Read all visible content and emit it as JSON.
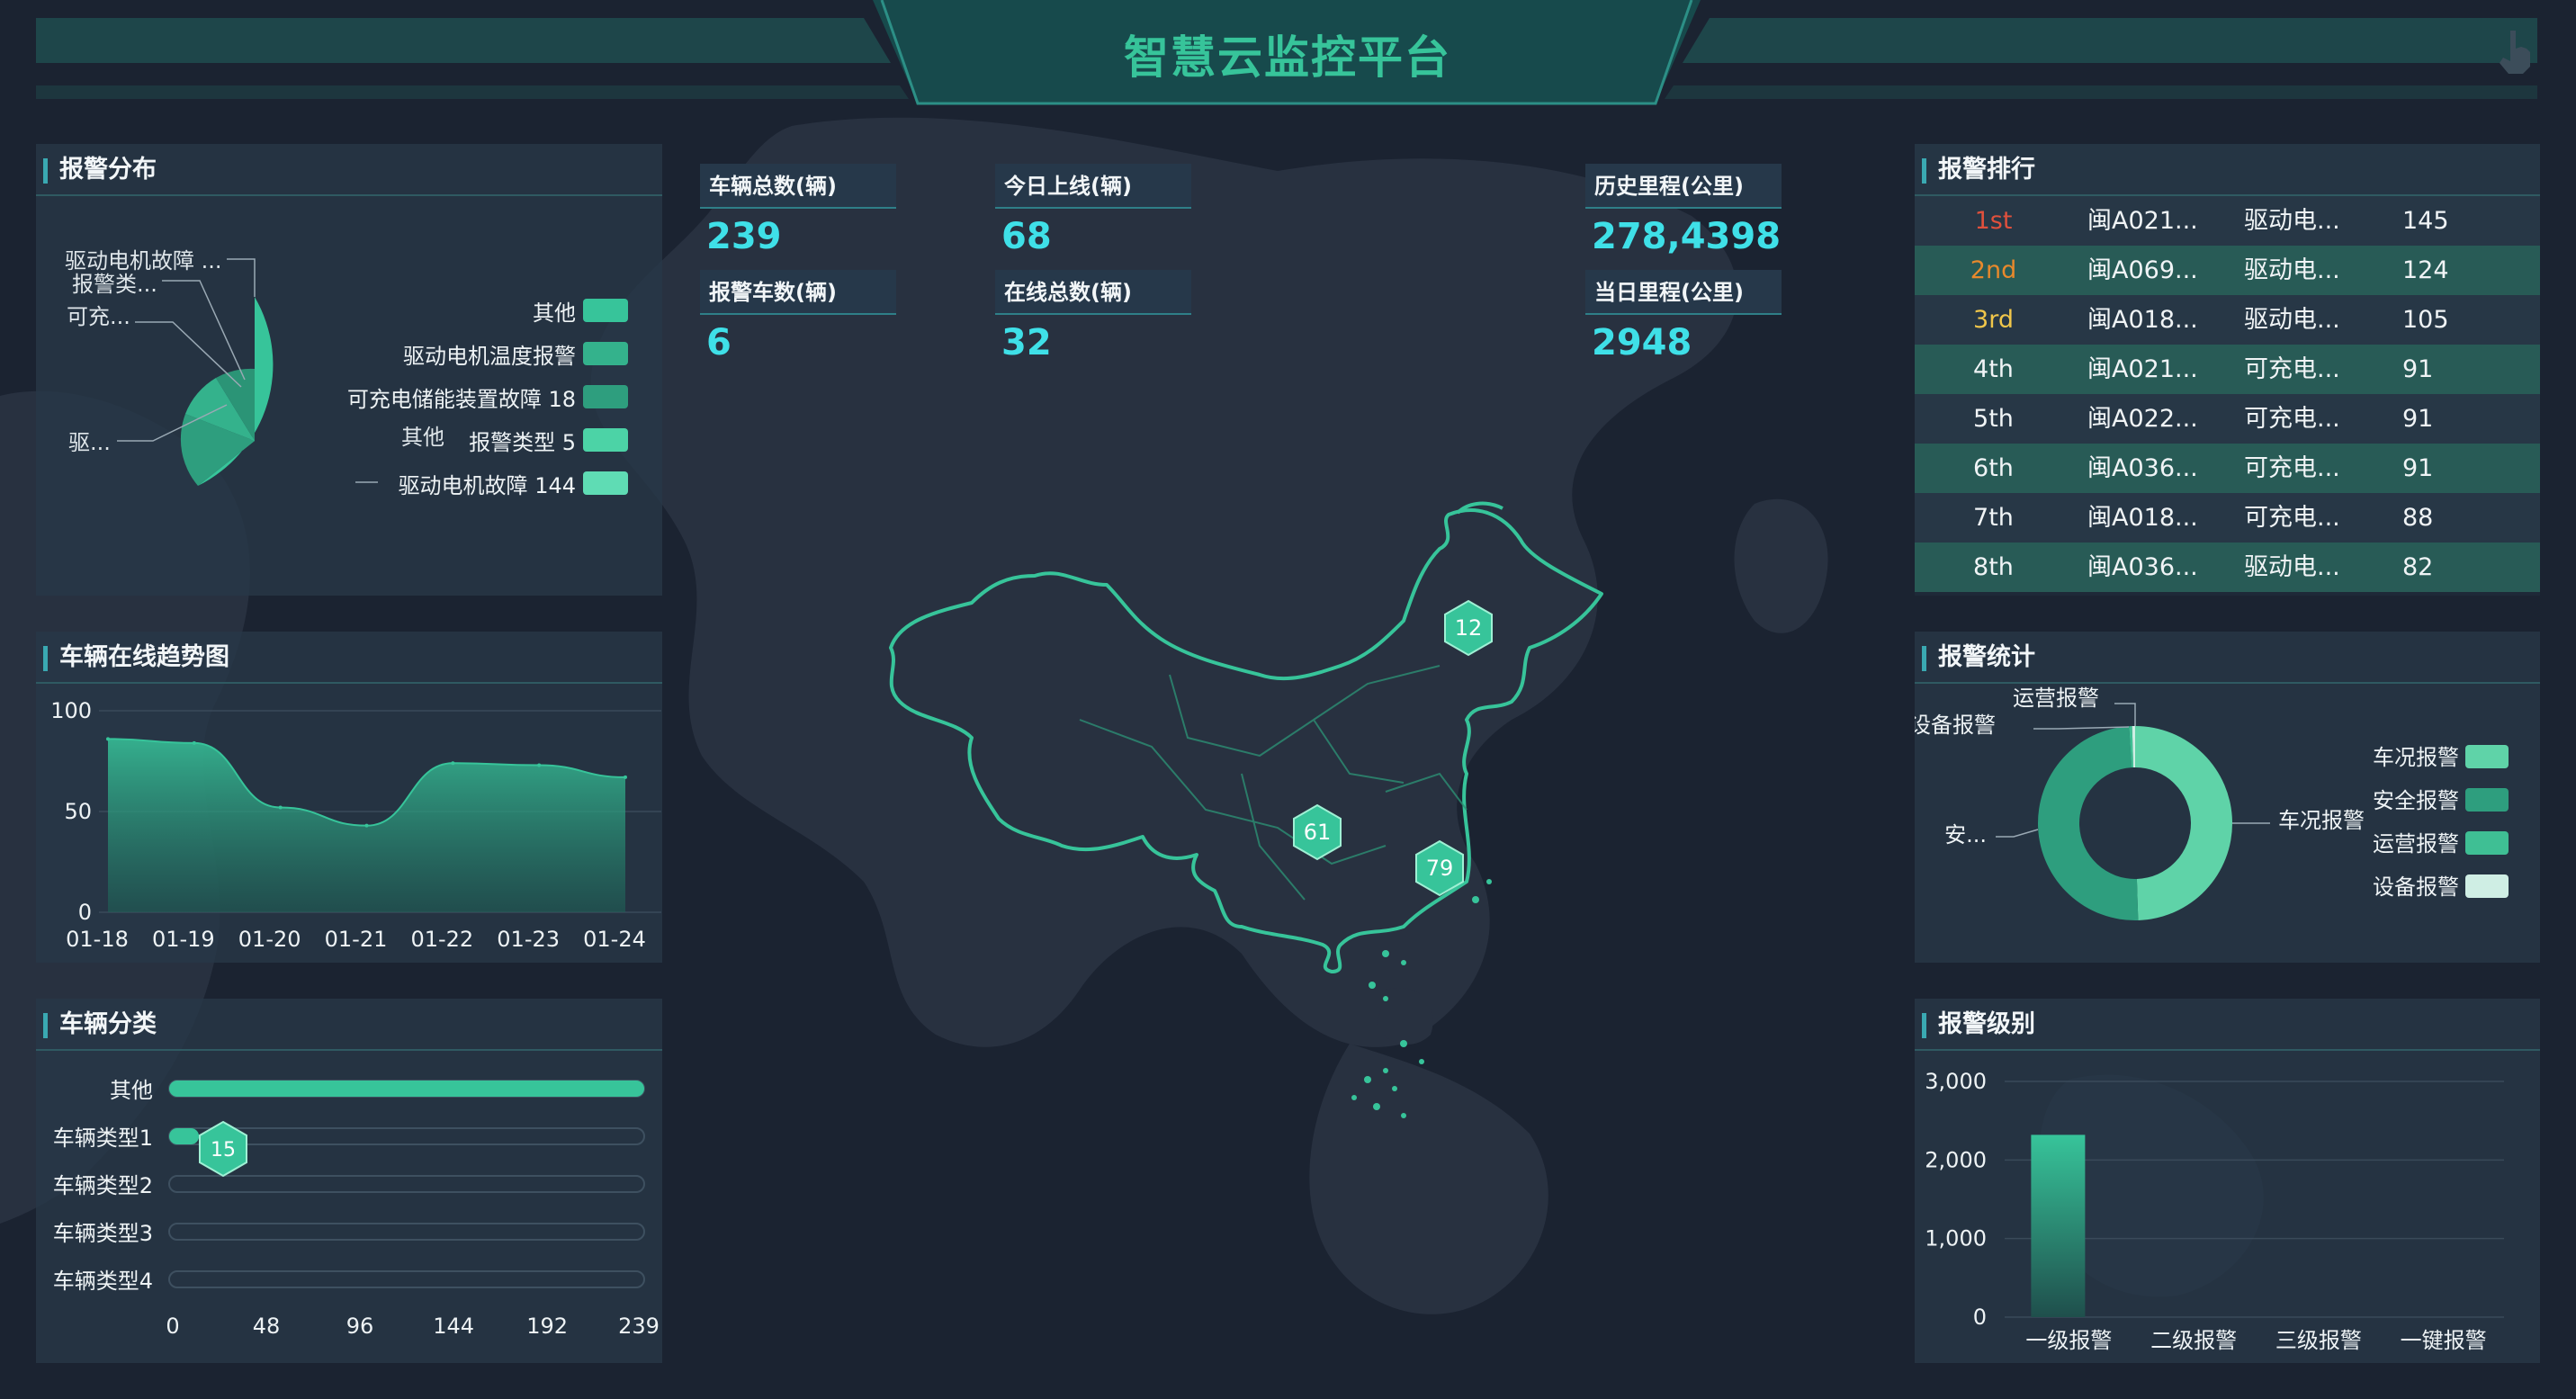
{
  "header": {
    "title": "智慧云监控平台"
  },
  "colors": {
    "accent": "#37c49a",
    "cyan": "#3fe0e8",
    "panel": "#283848",
    "gold": "#f0c64a",
    "red": "#e0503c",
    "orange": "#e8892c"
  },
  "panels": {
    "alarm_dist": "报警分布",
    "online_trend": "车辆在线趋势图",
    "vehicle_class": "车辆分类",
    "alarm_rank": "报警排行",
    "alarm_stats": "报警统计",
    "alarm_level": "报警级别"
  },
  "stats": [
    {
      "label": "车辆总数(辆)",
      "value": "239"
    },
    {
      "label": "今日上线(辆)",
      "value": "68"
    },
    {
      "label": "历史里程(公里)",
      "value": "278,4398"
    },
    {
      "label": "报警车数(辆)",
      "value": "6"
    },
    {
      "label": "在线总数(辆)",
      "value": "32"
    },
    {
      "label": "当日里程(公里)",
      "value": "2948"
    }
  ],
  "alarm_dist": {
    "callouts": [
      "驱动电机故障 ...",
      "报警类...",
      "可充...",
      "驱..."
    ],
    "legend": [
      {
        "text": "其他",
        "color": "#37c49a"
      },
      {
        "text": "驱动电机温度报警",
        "color": "#34b28c"
      },
      {
        "text": "可充电储能装置故障 18",
        "color": "#2e9e7e"
      },
      {
        "text": "报警类型 5",
        "color": "#4cd3a6"
      },
      {
        "text": "驱动电机故障 144",
        "color": "#5fdcb4"
      }
    ],
    "extra_label": "其他"
  },
  "chart_data": [
    {
      "type": "area",
      "title": "车辆在线趋势图",
      "x": [
        "01-18",
        "01-19",
        "01-20",
        "01-21",
        "01-22",
        "01-23",
        "01-24"
      ],
      "series": [
        {
          "values": [
            86,
            84,
            52,
            43,
            74,
            73,
            67
          ]
        }
      ],
      "yticks": [
        "0",
        "50",
        "100"
      ],
      "ylim": [
        0,
        100
      ]
    },
    {
      "type": "bar",
      "title": "车辆分类",
      "orientation": "horizontal",
      "categories": [
        "其他",
        "车辆类型1",
        "车辆类型2",
        "车辆类型3",
        "车辆类型4"
      ],
      "values": [
        239,
        15,
        0,
        0,
        0
      ],
      "xticks": [
        "0",
        "48",
        "96",
        "144",
        "192",
        "239"
      ],
      "xlim": [
        0,
        239
      ],
      "marker_label": "15"
    },
    {
      "type": "pie",
      "title": "报警统计",
      "slices": [
        {
          "label": "车况报警",
          "value": 50,
          "color": "#5fd3a8"
        },
        {
          "label": "安全报警",
          "value": 50,
          "color": "#2e9e7e"
        },
        {
          "label": "运营报警",
          "value": 0.5,
          "color": "#3fbf94"
        },
        {
          "label": "设备报警",
          "value": 0.5,
          "color": "#cfeee4"
        }
      ],
      "callouts": [
        "运营报警",
        "设备报警",
        "安...",
        "车况报警"
      ]
    },
    {
      "type": "bar",
      "title": "报警级别",
      "categories": [
        "一级报警",
        "二级报警",
        "三级报警",
        "一键报警"
      ],
      "values": [
        2320,
        0,
        0,
        0
      ],
      "yticks": [
        "0",
        "1,000",
        "2,000",
        "3,000"
      ],
      "ylim": [
        0,
        3000
      ]
    }
  ],
  "rank": {
    "rows": [
      {
        "rank": "1st",
        "plate": "闽A021...",
        "type": "驱动电...",
        "value": "145",
        "rank_color": "#e0503c"
      },
      {
        "rank": "2nd",
        "plate": "闽A069...",
        "type": "驱动电...",
        "value": "124",
        "rank_color": "#e8892c"
      },
      {
        "rank": "3rd",
        "plate": "闽A018...",
        "type": "驱动电...",
        "value": "105",
        "rank_color": "#f0c64a"
      },
      {
        "rank": "4th",
        "plate": "闽A021...",
        "type": "可充电...",
        "value": "91",
        "rank_color": "#f0f4f6"
      },
      {
        "rank": "5th",
        "plate": "闽A022...",
        "type": "可充电...",
        "value": "91",
        "rank_color": "#f0f4f6"
      },
      {
        "rank": "6th",
        "plate": "闽A036...",
        "type": "可充电...",
        "value": "91",
        "rank_color": "#f0f4f6"
      },
      {
        "rank": "7th",
        "plate": "闽A018...",
        "type": "可充电...",
        "value": "88",
        "rank_color": "#f0f4f6"
      },
      {
        "rank": "8th",
        "plate": "闽A036...",
        "type": "驱动电...",
        "value": "82",
        "rank_color": "#f0f4f6"
      }
    ]
  },
  "map_markers": [
    "12",
    "61",
    "79"
  ]
}
